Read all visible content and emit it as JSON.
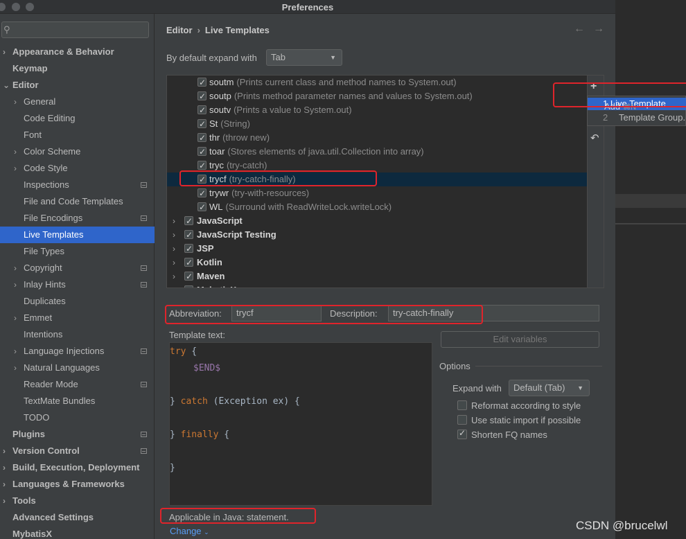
{
  "window": {
    "title": "Preferences"
  },
  "sidebar": {
    "search_placeholder": "",
    "items": [
      {
        "label": "Appearance & Behavior",
        "level": 0,
        "bold": true,
        "chevron": true,
        "proj": false
      },
      {
        "label": "Keymap",
        "level": 0,
        "bold": true,
        "chevron": false,
        "proj": false
      },
      {
        "label": "Editor",
        "level": 0,
        "bold": true,
        "chevron": true,
        "expanded": true,
        "proj": false
      },
      {
        "label": "General",
        "level": 1,
        "bold": false,
        "chevron": true,
        "proj": false
      },
      {
        "label": "Code Editing",
        "level": 1,
        "bold": false,
        "chevron": false,
        "proj": false
      },
      {
        "label": "Font",
        "level": 1,
        "bold": false,
        "chevron": false,
        "proj": false
      },
      {
        "label": "Color Scheme",
        "level": 1,
        "bold": false,
        "chevron": true,
        "proj": false
      },
      {
        "label": "Code Style",
        "level": 1,
        "bold": false,
        "chevron": true,
        "proj": false
      },
      {
        "label": "Inspections",
        "level": 1,
        "bold": false,
        "chevron": false,
        "proj": true
      },
      {
        "label": "File and Code Templates",
        "level": 1,
        "bold": false,
        "chevron": false,
        "proj": false
      },
      {
        "label": "File Encodings",
        "level": 1,
        "bold": false,
        "chevron": false,
        "proj": true
      },
      {
        "label": "Live Templates",
        "level": 1,
        "bold": false,
        "chevron": false,
        "proj": false,
        "selected": true
      },
      {
        "label": "File Types",
        "level": 1,
        "bold": false,
        "chevron": false,
        "proj": false
      },
      {
        "label": "Copyright",
        "level": 1,
        "bold": false,
        "chevron": true,
        "proj": true
      },
      {
        "label": "Inlay Hints",
        "level": 1,
        "bold": false,
        "chevron": true,
        "proj": true
      },
      {
        "label": "Duplicates",
        "level": 1,
        "bold": false,
        "chevron": false,
        "proj": false
      },
      {
        "label": "Emmet",
        "level": 1,
        "bold": false,
        "chevron": true,
        "proj": false
      },
      {
        "label": "Intentions",
        "level": 1,
        "bold": false,
        "chevron": false,
        "proj": false
      },
      {
        "label": "Language Injections",
        "level": 1,
        "bold": false,
        "chevron": true,
        "proj": true
      },
      {
        "label": "Natural Languages",
        "level": 1,
        "bold": false,
        "chevron": true,
        "proj": false
      },
      {
        "label": "Reader Mode",
        "level": 1,
        "bold": false,
        "chevron": false,
        "proj": true
      },
      {
        "label": "TextMate Bundles",
        "level": 1,
        "bold": false,
        "chevron": false,
        "proj": false
      },
      {
        "label": "TODO",
        "level": 1,
        "bold": false,
        "chevron": false,
        "proj": false
      },
      {
        "label": "Plugins",
        "level": 0,
        "bold": true,
        "chevron": false,
        "proj": true
      },
      {
        "label": "Version Control",
        "level": 0,
        "bold": true,
        "chevron": true,
        "proj": true
      },
      {
        "label": "Build, Execution, Deployment",
        "level": 0,
        "bold": true,
        "chevron": true,
        "proj": false
      },
      {
        "label": "Languages & Frameworks",
        "level": 0,
        "bold": true,
        "chevron": true,
        "proj": false
      },
      {
        "label": "Tools",
        "level": 0,
        "bold": true,
        "chevron": true,
        "proj": false
      },
      {
        "label": "Advanced Settings",
        "level": 0,
        "bold": true,
        "chevron": false,
        "proj": false
      },
      {
        "label": "MybatisX",
        "level": 0,
        "bold": true,
        "chevron": false,
        "proj": false
      }
    ]
  },
  "header": {
    "crumb1": "Editor",
    "crumb2": "Live Templates"
  },
  "expand_default": {
    "label": "By default expand with",
    "value": "Tab"
  },
  "templates": [
    {
      "name": "soutm",
      "desc": "(Prints current class and method names to System.out)",
      "group": false,
      "checked": true
    },
    {
      "name": "soutp",
      "desc": "(Prints method parameter names and values to System.out)",
      "group": false,
      "checked": true
    },
    {
      "name": "soutv",
      "desc": "(Prints a value to System.out)",
      "group": false,
      "checked": true
    },
    {
      "name": "St",
      "desc": "(String)",
      "group": false,
      "checked": true
    },
    {
      "name": "thr",
      "desc": "(throw new)",
      "group": false,
      "checked": true
    },
    {
      "name": "toar",
      "desc": "(Stores elements of java.util.Collection into array)",
      "group": false,
      "checked": true
    },
    {
      "name": "tryc",
      "desc": "(try-catch)",
      "group": false,
      "checked": true
    },
    {
      "name": "trycf",
      "desc": "(try-catch-finally)",
      "group": false,
      "checked": true,
      "selected": true
    },
    {
      "name": "trywr",
      "desc": "(try-with-resources)",
      "group": false,
      "checked": true
    },
    {
      "name": "WL",
      "desc": "(Surround with ReadWriteLock.writeLock)",
      "group": false,
      "checked": true
    },
    {
      "name": "JavaScript",
      "desc": "",
      "group": true,
      "checked": true
    },
    {
      "name": "JavaScript Testing",
      "desc": "",
      "group": true,
      "checked": true
    },
    {
      "name": "JSP",
      "desc": "",
      "group": true,
      "checked": true
    },
    {
      "name": "Kotlin",
      "desc": "",
      "group": true,
      "checked": true
    },
    {
      "name": "Maven",
      "desc": "",
      "group": true,
      "checked": true
    },
    {
      "name": "MybatisX",
      "desc": "",
      "group": true,
      "checked": true
    }
  ],
  "popup": {
    "item1": "1  Live Template",
    "item2_num": "2",
    "item2": "Template Group...",
    "add_label": "Add",
    "add_shortcut": "⌘N"
  },
  "fields": {
    "abbrev_label": "Abbreviation:",
    "abbrev_value": "trycf",
    "desc_label": "Description:",
    "desc_value": "try-catch-finally",
    "template_text_label": "Template text:"
  },
  "code": {
    "l1_kw": "try",
    "l1_rest": " {",
    "l2_var": "$END$",
    "l4_a": "} ",
    "l4_kw": "catch",
    "l4_rest": " (Exception ex) {",
    "l6_a": "} ",
    "l6_kw": "finally",
    "l6_rest": " {",
    "l8": "}"
  },
  "edit_variables": "Edit variables",
  "options": {
    "title": "Options",
    "expand_label": "Expand with",
    "expand_value": "Default (Tab)",
    "reformat": "Reformat according to style",
    "static_import": "Use static import if possible",
    "shorten_fq": "Shorten FQ names"
  },
  "applicable": "Applicable in Java: statement.",
  "change_link": "Change",
  "watermark": "CSDN @brucelwl"
}
